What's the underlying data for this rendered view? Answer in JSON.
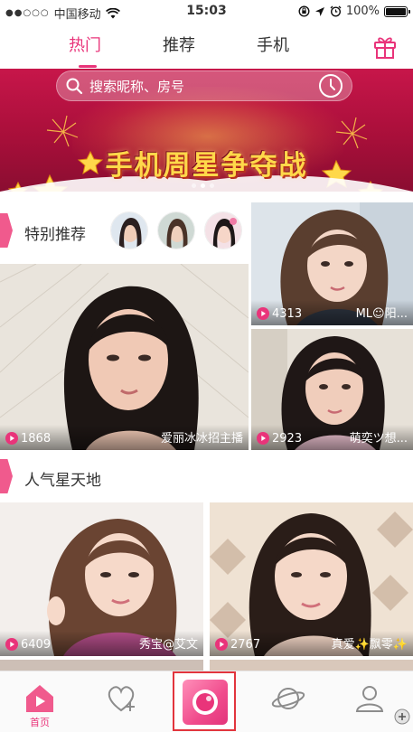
{
  "status_bar": {
    "carrier": "中国移动",
    "signal": "●●○○○",
    "time": "15:03",
    "battery": "100%",
    "battery_level": 1.0
  },
  "tabs": [
    {
      "label": "热门",
      "active": true
    },
    {
      "label": "推荐",
      "active": false
    },
    {
      "label": "手机",
      "active": false
    }
  ],
  "search": {
    "placeholder": "搜索昵称、房号"
  },
  "banner": {
    "title": "手机周星争夺战",
    "slide_count": 3,
    "active_slide": 2
  },
  "featured": {
    "title": "特别推荐",
    "avatars": [
      "avatar-1",
      "avatar-2",
      "avatar-3"
    ]
  },
  "featured_cards": [
    {
      "views": "1868",
      "name": "爱丽冰冰招主播"
    },
    {
      "views": "4313",
      "name": "ML☺阳..."
    },
    {
      "views": "2923",
      "name": "萌奕ツ想..."
    }
  ],
  "popular": {
    "title": "人气星天地"
  },
  "popular_cards": [
    {
      "views": "6409",
      "name": "秀宝@艾文"
    },
    {
      "views": "2767",
      "name": "真爱✨飘零✨"
    }
  ],
  "bottom_nav": {
    "home_label": "首页",
    "items": [
      "home-icon",
      "follow-icon",
      "live-button",
      "discover-icon",
      "profile-icon"
    ]
  },
  "colors": {
    "accent": "#e9347a",
    "banner": "#b8123f",
    "highlight_frame": "#e2353d"
  }
}
